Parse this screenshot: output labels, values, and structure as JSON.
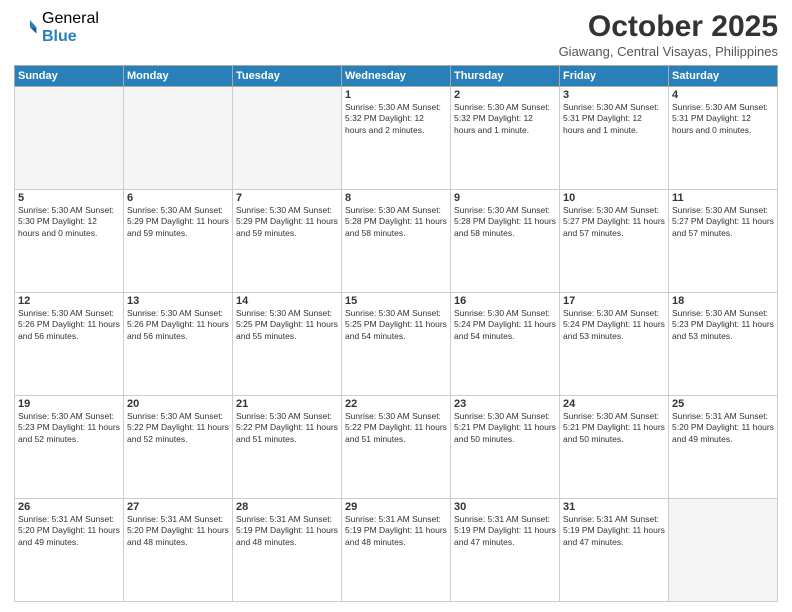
{
  "logo": {
    "general": "General",
    "blue": "Blue"
  },
  "header": {
    "month": "October 2025",
    "location": "Giawang, Central Visayas, Philippines"
  },
  "weekdays": [
    "Sunday",
    "Monday",
    "Tuesday",
    "Wednesday",
    "Thursday",
    "Friday",
    "Saturday"
  ],
  "weeks": [
    [
      {
        "day": "",
        "info": ""
      },
      {
        "day": "",
        "info": ""
      },
      {
        "day": "",
        "info": ""
      },
      {
        "day": "1",
        "info": "Sunrise: 5:30 AM\nSunset: 5:32 PM\nDaylight: 12 hours and 2 minutes."
      },
      {
        "day": "2",
        "info": "Sunrise: 5:30 AM\nSunset: 5:32 PM\nDaylight: 12 hours and 1 minute."
      },
      {
        "day": "3",
        "info": "Sunrise: 5:30 AM\nSunset: 5:31 PM\nDaylight: 12 hours and 1 minute."
      },
      {
        "day": "4",
        "info": "Sunrise: 5:30 AM\nSunset: 5:31 PM\nDaylight: 12 hours and 0 minutes."
      }
    ],
    [
      {
        "day": "5",
        "info": "Sunrise: 5:30 AM\nSunset: 5:30 PM\nDaylight: 12 hours and 0 minutes."
      },
      {
        "day": "6",
        "info": "Sunrise: 5:30 AM\nSunset: 5:29 PM\nDaylight: 11 hours and 59 minutes."
      },
      {
        "day": "7",
        "info": "Sunrise: 5:30 AM\nSunset: 5:29 PM\nDaylight: 11 hours and 59 minutes."
      },
      {
        "day": "8",
        "info": "Sunrise: 5:30 AM\nSunset: 5:28 PM\nDaylight: 11 hours and 58 minutes."
      },
      {
        "day": "9",
        "info": "Sunrise: 5:30 AM\nSunset: 5:28 PM\nDaylight: 11 hours and 58 minutes."
      },
      {
        "day": "10",
        "info": "Sunrise: 5:30 AM\nSunset: 5:27 PM\nDaylight: 11 hours and 57 minutes."
      },
      {
        "day": "11",
        "info": "Sunrise: 5:30 AM\nSunset: 5:27 PM\nDaylight: 11 hours and 57 minutes."
      }
    ],
    [
      {
        "day": "12",
        "info": "Sunrise: 5:30 AM\nSunset: 5:26 PM\nDaylight: 11 hours and 56 minutes."
      },
      {
        "day": "13",
        "info": "Sunrise: 5:30 AM\nSunset: 5:26 PM\nDaylight: 11 hours and 56 minutes."
      },
      {
        "day": "14",
        "info": "Sunrise: 5:30 AM\nSunset: 5:25 PM\nDaylight: 11 hours and 55 minutes."
      },
      {
        "day": "15",
        "info": "Sunrise: 5:30 AM\nSunset: 5:25 PM\nDaylight: 11 hours and 54 minutes."
      },
      {
        "day": "16",
        "info": "Sunrise: 5:30 AM\nSunset: 5:24 PM\nDaylight: 11 hours and 54 minutes."
      },
      {
        "day": "17",
        "info": "Sunrise: 5:30 AM\nSunset: 5:24 PM\nDaylight: 11 hours and 53 minutes."
      },
      {
        "day": "18",
        "info": "Sunrise: 5:30 AM\nSunset: 5:23 PM\nDaylight: 11 hours and 53 minutes."
      }
    ],
    [
      {
        "day": "19",
        "info": "Sunrise: 5:30 AM\nSunset: 5:23 PM\nDaylight: 11 hours and 52 minutes."
      },
      {
        "day": "20",
        "info": "Sunrise: 5:30 AM\nSunset: 5:22 PM\nDaylight: 11 hours and 52 minutes."
      },
      {
        "day": "21",
        "info": "Sunrise: 5:30 AM\nSunset: 5:22 PM\nDaylight: 11 hours and 51 minutes."
      },
      {
        "day": "22",
        "info": "Sunrise: 5:30 AM\nSunset: 5:22 PM\nDaylight: 11 hours and 51 minutes."
      },
      {
        "day": "23",
        "info": "Sunrise: 5:30 AM\nSunset: 5:21 PM\nDaylight: 11 hours and 50 minutes."
      },
      {
        "day": "24",
        "info": "Sunrise: 5:30 AM\nSunset: 5:21 PM\nDaylight: 11 hours and 50 minutes."
      },
      {
        "day": "25",
        "info": "Sunrise: 5:31 AM\nSunset: 5:20 PM\nDaylight: 11 hours and 49 minutes."
      }
    ],
    [
      {
        "day": "26",
        "info": "Sunrise: 5:31 AM\nSunset: 5:20 PM\nDaylight: 11 hours and 49 minutes."
      },
      {
        "day": "27",
        "info": "Sunrise: 5:31 AM\nSunset: 5:20 PM\nDaylight: 11 hours and 48 minutes."
      },
      {
        "day": "28",
        "info": "Sunrise: 5:31 AM\nSunset: 5:19 PM\nDaylight: 11 hours and 48 minutes."
      },
      {
        "day": "29",
        "info": "Sunrise: 5:31 AM\nSunset: 5:19 PM\nDaylight: 11 hours and 48 minutes."
      },
      {
        "day": "30",
        "info": "Sunrise: 5:31 AM\nSunset: 5:19 PM\nDaylight: 11 hours and 47 minutes."
      },
      {
        "day": "31",
        "info": "Sunrise: 5:31 AM\nSunset: 5:19 PM\nDaylight: 11 hours and 47 minutes."
      },
      {
        "day": "",
        "info": ""
      }
    ]
  ]
}
